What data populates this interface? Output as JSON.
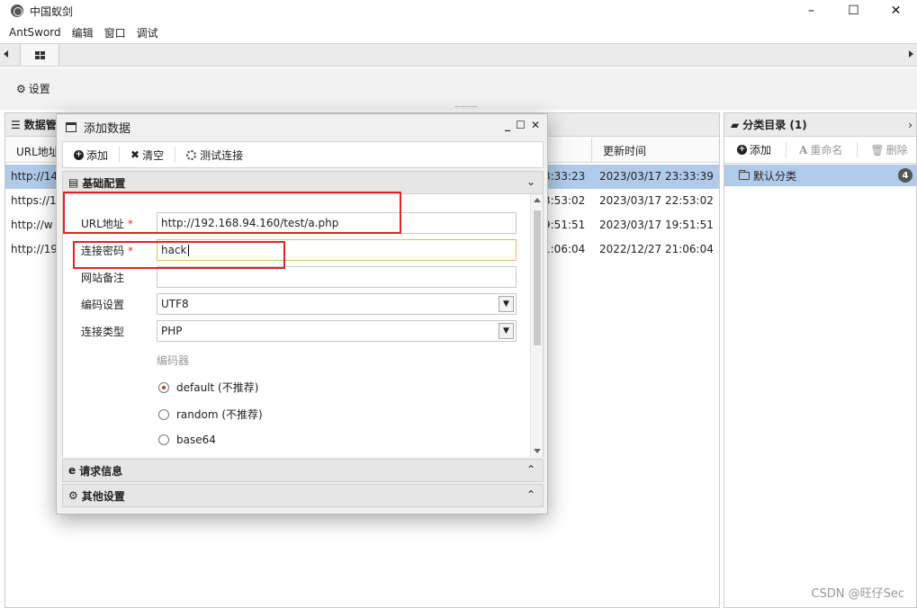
{
  "window": {
    "title": "中国蚁剑",
    "controls": {
      "minimize": "–",
      "maximize": "☐",
      "close": "✕"
    }
  },
  "menu": [
    "AntSword",
    "编辑",
    "窗口",
    "调试"
  ],
  "toolbar": {
    "settings_label": "设置"
  },
  "data_panel": {
    "title": "数据管",
    "columns": {
      "url": "URL地址",
      "updated": "更新时间"
    },
    "rows": [
      {
        "url": "http://14",
        "created": "3:33:23",
        "updated": "2023/03/17 23:33:39",
        "selected": true
      },
      {
        "url": "https://1",
        "created": "3:53:02",
        "updated": "2023/03/17 22:53:02",
        "selected": false
      },
      {
        "url": "http://w",
        "created": "9:51:51",
        "updated": "2023/03/17 19:51:51",
        "selected": false
      },
      {
        "url": "http://19",
        "created": "1:06:04",
        "updated": "2022/12/27 21:06:04",
        "selected": false
      }
    ]
  },
  "category_panel": {
    "title": "分类目录 (1)",
    "toolbar": {
      "add": "添加",
      "rename": "重命名",
      "delete": "删除"
    },
    "items": [
      {
        "label": "默认分类",
        "count": "4"
      }
    ]
  },
  "dialog": {
    "title": "添加数据",
    "toolbar": {
      "add": "添加",
      "clear": "清空",
      "test": "测试连接"
    },
    "sections": {
      "basic": "基础配置",
      "request": "请求信息",
      "other": "其他设置"
    },
    "form": {
      "url_label": "URL地址",
      "url_value": "http://192.168.94.160/test/a.php",
      "password_label": "连接密码",
      "password_value": "hack",
      "note_label": "网站备注",
      "note_value": "",
      "encoding_label": "编码设置",
      "encoding_value": "UTF8",
      "type_label": "连接类型",
      "type_value": "PHP",
      "encoder_label": "编码器",
      "encoders": [
        {
          "label": "default (不推荐)",
          "checked": true
        },
        {
          "label": "random (不推荐)",
          "checked": false
        },
        {
          "label": "base64",
          "checked": false
        }
      ],
      "required_mark": "*"
    }
  },
  "watermark": "CSDN @旺仔Sec",
  "colors": {
    "selection": "#b0cbe9",
    "annotation_red": "#e02424",
    "focus_border": "#e6b86a"
  }
}
